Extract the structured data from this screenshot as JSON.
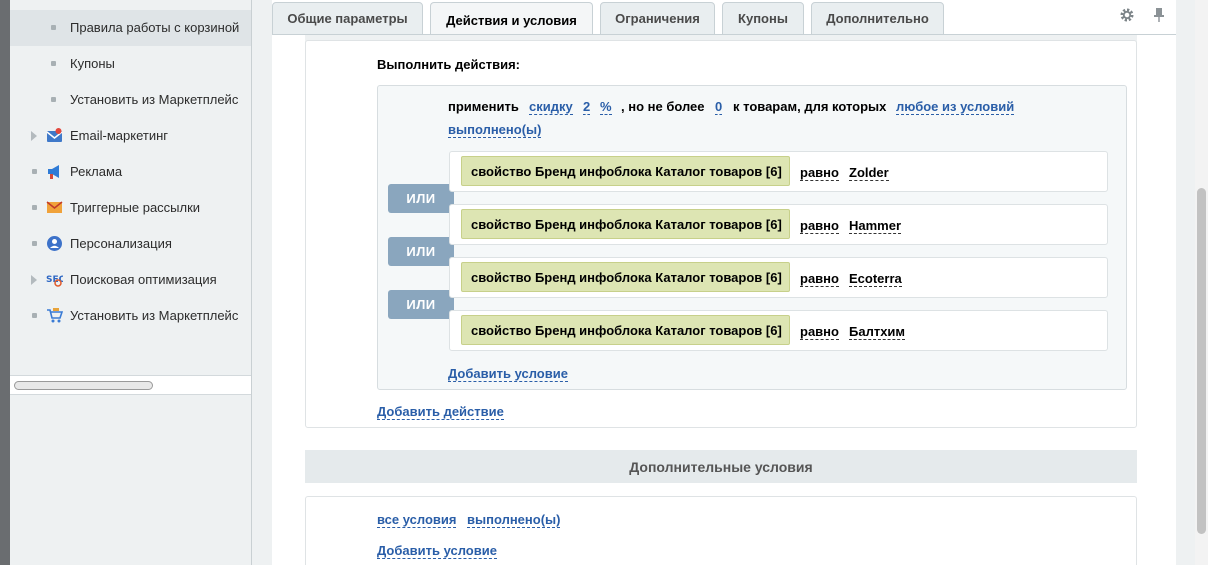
{
  "sidebar": {
    "items": [
      {
        "label": "Правила работы с корзиной",
        "icon": "bullet",
        "selected": true
      },
      {
        "label": "Купоны",
        "icon": "bullet"
      },
      {
        "label": "Установить из Маркетплейс",
        "icon": "bullet"
      },
      {
        "label": "Email-маркетинг",
        "icon": "email-marketing-icon",
        "expandable": true
      },
      {
        "label": "Реклама",
        "icon": "megaphone-icon"
      },
      {
        "label": "Триггерные рассылки",
        "icon": "trigger-mail-icon"
      },
      {
        "label": "Персонализация",
        "icon": "person-icon"
      },
      {
        "label": "Поисковая оптимизация",
        "icon": "seo-icon",
        "expandable": true
      },
      {
        "label": "Установить из Маркетплейс",
        "icon": "cart-icon"
      }
    ]
  },
  "tabs": [
    {
      "label": "Общие параметры"
    },
    {
      "label": "Действия и условия",
      "active": true
    },
    {
      "label": "Ограничения"
    },
    {
      "label": "Купоны"
    },
    {
      "label": "Дополнительно"
    }
  ],
  "actions": {
    "heading": "Выполнить действия:",
    "apply_label": "применить",
    "discount_type": "скидку",
    "discount_value": "2",
    "discount_unit": "%",
    "max_label": ", но не более",
    "max_value": "0",
    "goods_label": "к товарам, для которых",
    "condition_mode": "любое из условий",
    "condition_result": "выполнено(ы)",
    "or_label": "ИЛИ",
    "conditions": [
      {
        "property": "свойство Бренд инфоблока Каталог товаров [6]",
        "operator": "равно",
        "value": "Zolder"
      },
      {
        "property": "свойство Бренд инфоблока Каталог товаров [6]",
        "operator": "равно",
        "value": "Hammer"
      },
      {
        "property": "свойство Бренд инфоблока Каталог товаров [6]",
        "operator": "равно",
        "value": "Ecoterra"
      },
      {
        "property": "свойство Бренд инфоблока Каталог товаров [6]",
        "operator": "равно",
        "value": "Балтхим"
      }
    ],
    "add_condition": "Добавить условие",
    "add_action": "Добавить действие"
  },
  "extra": {
    "header": "Дополнительные условия",
    "all_conditions": "все условия",
    "fulfilled": "выполнено(ы)",
    "add_condition": "Добавить условие"
  },
  "colors": {
    "accent_link": "#2a5ea8",
    "condition_bg": "#dde5b3",
    "or_button": "#8aa6be"
  }
}
